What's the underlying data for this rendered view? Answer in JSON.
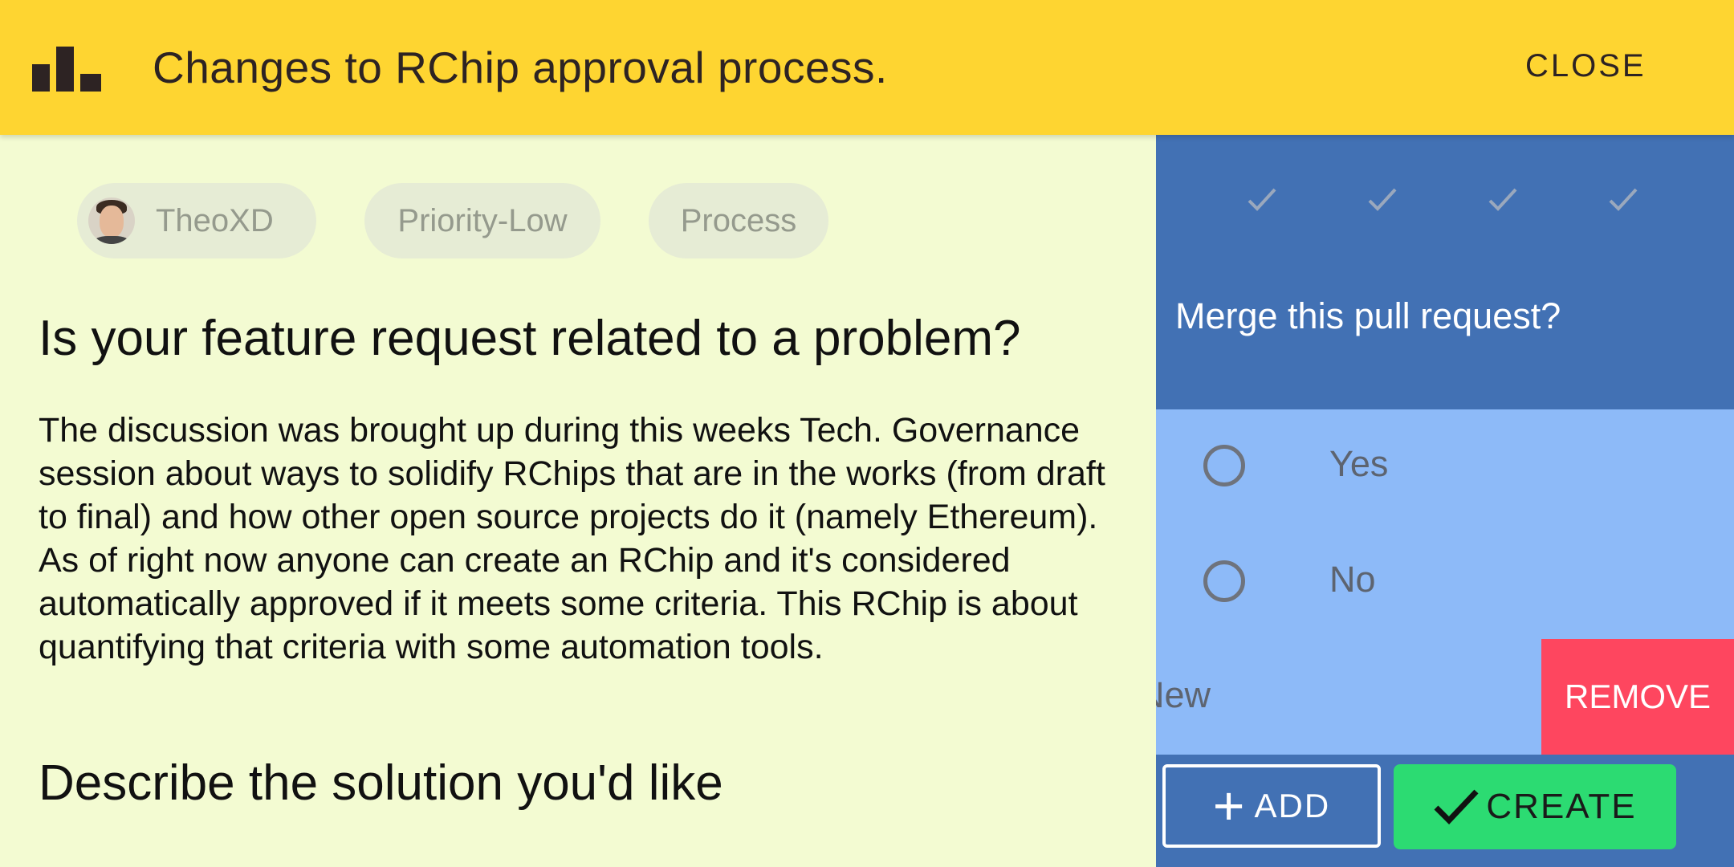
{
  "header": {
    "title": "Changes to RChip approval process.",
    "close_label": "CLOSE",
    "background": "#fed531"
  },
  "chips": {
    "author": "TheoXD",
    "priority": "Priority-Low",
    "category": "Process"
  },
  "article": {
    "heading1": "Is your feature request related to a problem?",
    "paragraph1": "The discussion was brought up during this weeks Tech. Governance session about ways to solidify RChips that are in the works (from draft to final) and how other open source projects do it (namely Ethereum). As of right now anyone can create an RChip and it's considered automatically approved if it meets some criteria. This RChip is about quantifying that criteria with some automation tools.",
    "heading2": "Describe the solution you'd like"
  },
  "poll": {
    "question": "Merge this pull request?",
    "options": [
      {
        "label": "Yes"
      },
      {
        "label": "No"
      }
    ],
    "new_label": "New",
    "remove_label": "REMOVE",
    "add_label": "ADD",
    "create_label": "CREATE"
  },
  "colors": {
    "panel_dark": "#4271b4",
    "panel_light": "#8dbaf8",
    "remove": "#fe465f",
    "create": "#2cdb72",
    "content_bg": "#f3fbd2"
  }
}
